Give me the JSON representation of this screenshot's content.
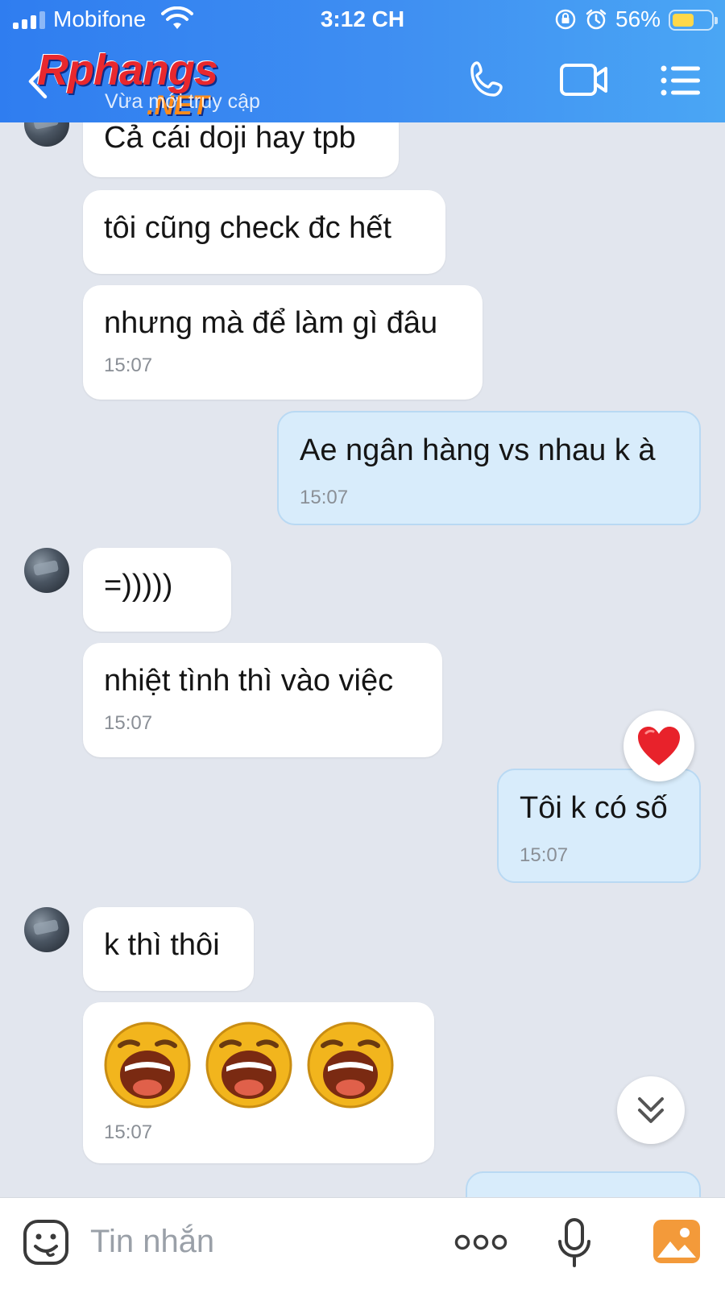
{
  "status_bar": {
    "carrier": "Mobifone",
    "time": "3:12 CH",
    "battery": "56%",
    "battery_level": 0.56
  },
  "header": {
    "logo_main": "Rphangs",
    "logo_net": ".NET",
    "subtitle": "Vừa mới truy cập",
    "icons": [
      "back-icon",
      "phone-call-icon",
      "video-call-icon",
      "menu-list-icon"
    ]
  },
  "messages": [
    {
      "side": "in",
      "text": "Cả cái doji hay tpb",
      "time": ""
    },
    {
      "side": "in",
      "text": "tôi cũng check đc hết",
      "time": ""
    },
    {
      "side": "in",
      "text": "nhưng mà để làm gì đâu",
      "time": "15:07"
    },
    {
      "side": "out",
      "text": "Ae ngân hàng vs nhau k à",
      "time": "15:07"
    },
    {
      "side": "in",
      "text": "=)))))",
      "time": ""
    },
    {
      "side": "in",
      "text": "nhiệt tình thì vào việc",
      "time": "15:07"
    },
    {
      "side": "out",
      "text": "Tôi k có số",
      "time": "15:07",
      "reaction": "heart-icon"
    },
    {
      "side": "in",
      "text": "k thì thôi",
      "time": ""
    },
    {
      "side": "in",
      "emojis": [
        "laughing-emoji",
        "laughing-emoji",
        "laughing-emoji"
      ],
      "time": "15:07"
    }
  ],
  "composer": {
    "placeholder": "Tin nhắn",
    "icons": [
      "sticker-icon",
      "more-options-icon",
      "microphone-icon",
      "photo-icon"
    ]
  },
  "colors": {
    "header_gradient_start": "#2f7df0",
    "header_gradient_end": "#4aa6f4",
    "chat_background": "#e2e6ee",
    "incoming_bubble": "#ffffff",
    "outgoing_bubble": "#d8ecfb",
    "photo_icon": "#f39a3a"
  }
}
